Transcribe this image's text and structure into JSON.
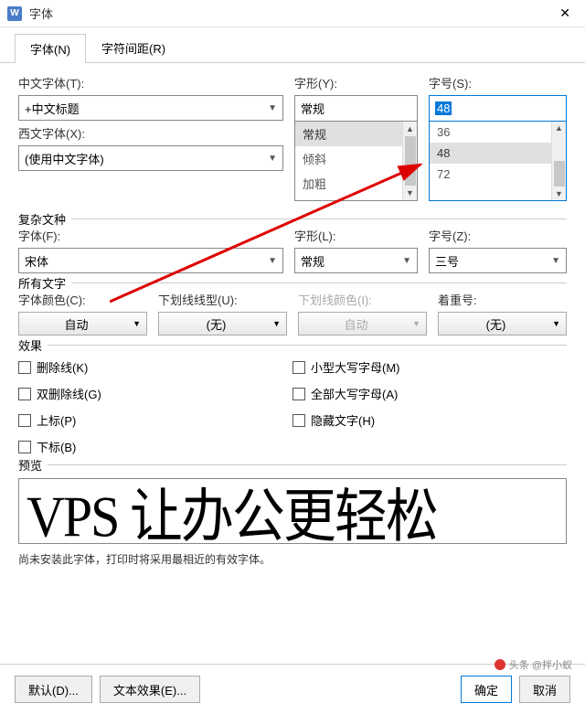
{
  "title": "字体",
  "tabs": {
    "font": "字体(N)",
    "spacing": "字符间距(R)"
  },
  "chinese_font": {
    "label": "中文字体(T):",
    "value": "+中文标题"
  },
  "style": {
    "label": "字形(Y):",
    "value": "常规",
    "options": [
      "常规",
      "倾斜",
      "加粗"
    ]
  },
  "size": {
    "label": "字号(S):",
    "value": "48",
    "options": [
      "36",
      "48",
      "72"
    ]
  },
  "western_font": {
    "label": "西文字体(X):",
    "value": "(使用中文字体)"
  },
  "complex": {
    "legend": "复杂文种",
    "font_label": "字体(F):",
    "font_value": "宋体",
    "style_label": "字形(L):",
    "style_value": "常规",
    "size_label": "字号(Z):",
    "size_value": "三号"
  },
  "all_text": {
    "legend": "所有文字",
    "color_label": "字体颜色(C):",
    "color_value": "自动",
    "underline_label": "下划线线型(U):",
    "underline_value": "(无)",
    "underline_color_label": "下划线颜色(I):",
    "underline_color_value": "自动",
    "emphasis_label": "着重号:",
    "emphasis_value": "(无)"
  },
  "effects": {
    "legend": "效果",
    "strike": "删除线(K)",
    "dblstrike": "双删除线(G)",
    "super": "上标(P)",
    "sub": "下标(B)",
    "smallcaps": "小型大写字母(M)",
    "allcaps": "全部大写字母(A)",
    "hidden": "隐藏文字(H)"
  },
  "preview": {
    "legend": "预览",
    "text": "VPS 让办公更轻松",
    "hint": "尚未安装此字体，打印时将采用最相近的有效字体。"
  },
  "buttons": {
    "default": "默认(D)...",
    "text_effect": "文本效果(E)...",
    "ok": "确定",
    "cancel": "取消"
  },
  "watermark": "头条 @拌小蚁"
}
